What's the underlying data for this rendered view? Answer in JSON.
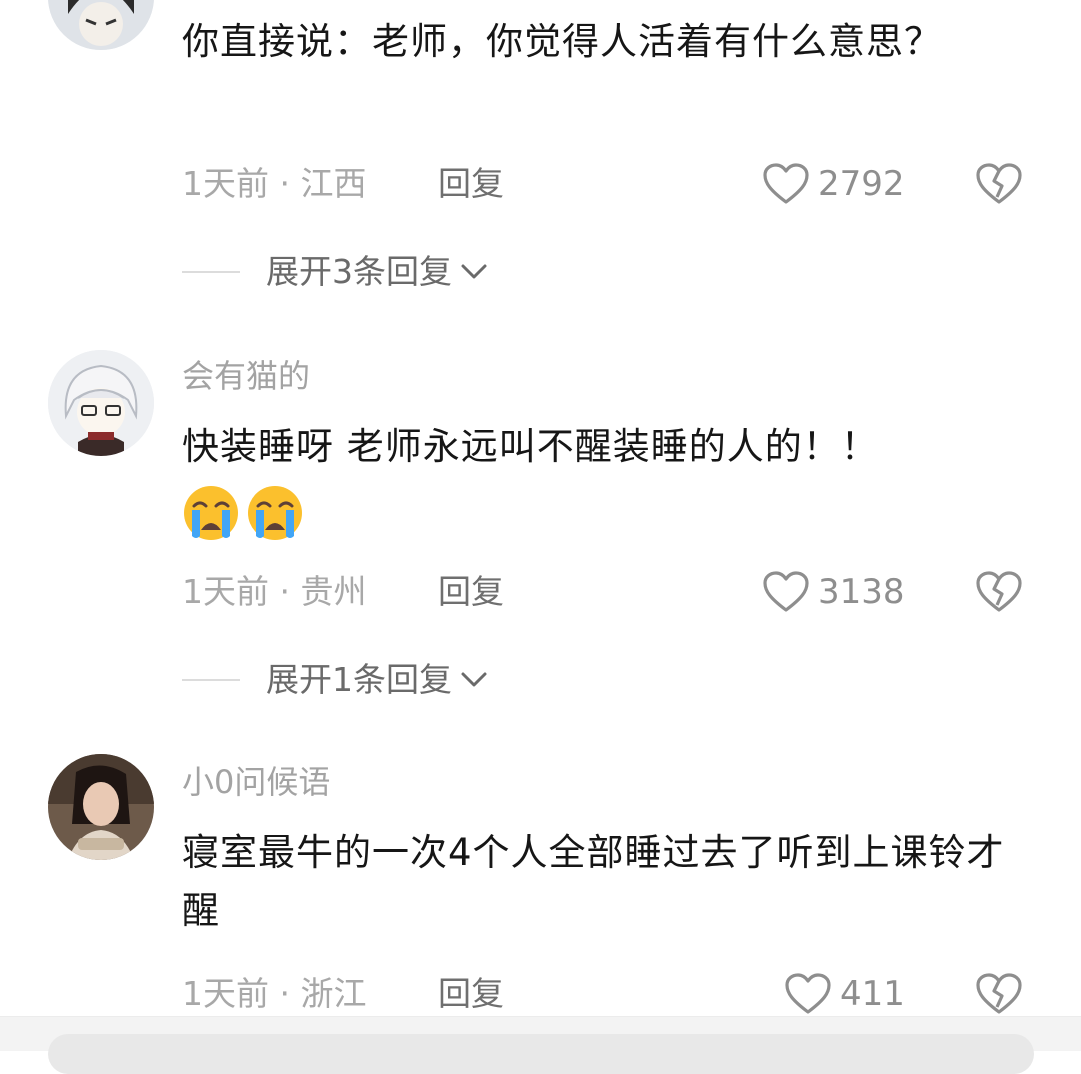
{
  "comments": [
    {
      "text": "你直接说：老师，你觉得人活着有什么意思？",
      "time_location": "1天前 · 江西",
      "reply_label": "回复",
      "likes": "2792",
      "expand_label": "展开3条回复"
    },
    {
      "username": "会有猫的",
      "text": "快装睡呀  老师永远叫不醒装睡的人的！！",
      "emojis": [
        "crying-face",
        "crying-face"
      ],
      "time_location": "1天前 · 贵州",
      "reply_label": "回复",
      "likes": "3138",
      "expand_label": "展开1条回复"
    },
    {
      "username": "小0问候语",
      "text": "寝室最牛的一次4个人全部睡过去了听到上课铃才醒",
      "time_location": "1天前 · 浙江",
      "reply_label": "回复",
      "likes": "411"
    }
  ],
  "colors": {
    "text": "#161616",
    "muted": "#a8a8a8",
    "icon": "#8e8e8e",
    "emoji_face": "#fbc02d",
    "emoji_tear": "#42a5f5"
  }
}
